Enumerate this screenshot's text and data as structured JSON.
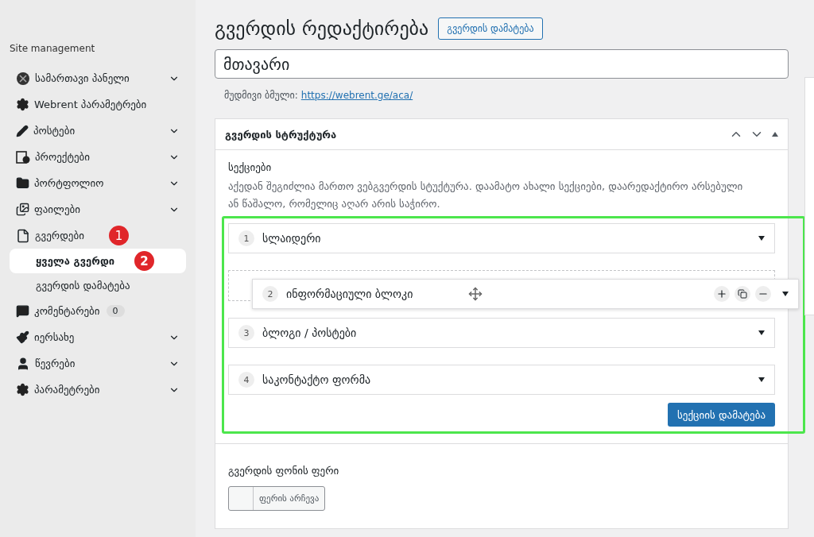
{
  "sidebar": {
    "heading": "Site management",
    "items": [
      {
        "label": "სამართავი პანელი",
        "chevron": true
      },
      {
        "label": "Webrent პარამეტრები",
        "chevron": false
      },
      {
        "label": "პოსტები",
        "chevron": true
      },
      {
        "label": "პროექტები",
        "chevron": true
      },
      {
        "label": "პორტფოლიო",
        "chevron": true
      },
      {
        "label": "ფაილები",
        "chevron": true
      },
      {
        "label": "გვერდები",
        "chevron": false,
        "marker": "1",
        "children": [
          {
            "label": "ყველა გვერდი",
            "selected": true,
            "marker": "2"
          },
          {
            "label": "გვერდის დამატება",
            "selected": false
          }
        ]
      },
      {
        "label": "კომენტარები",
        "chevron": false,
        "count": "0"
      },
      {
        "label": "იერსახე",
        "chevron": true
      },
      {
        "label": "წევრები",
        "chevron": true
      },
      {
        "label": "პარამეტრები",
        "chevron": true
      }
    ]
  },
  "header": {
    "title": "გვერდის რედაქტირება",
    "add_button": "გვერდის დამატება"
  },
  "title_field": {
    "value": "მთავარი"
  },
  "permalink": {
    "label": "მუდმივი ბმული:",
    "url": "https://webrent.ge/aca/"
  },
  "structure_panel": {
    "title": "გვერდის სტრუქტურა",
    "sections_label": "სექციები",
    "description": "აქედან შეგიძლია მართო ვებგვერდის სტუქტურა. დაამატო ახალი სექციები, დაარედაქტირო არსებული ან წაშალო, რომელიც აღარ არის საჭირო.",
    "sections": [
      {
        "number": "1",
        "title": "სლაიდერი",
        "dragging": false
      },
      {
        "number": "2",
        "title": "ინფორმაციული ბლოკი",
        "dragging": true
      },
      {
        "number": "3",
        "title": "ბლოგი / პოსტები",
        "dragging": false
      },
      {
        "number": "4",
        "title": "საკონტაქტო ფორმა",
        "dragging": false
      }
    ],
    "add_section_button": "სექციის დამატება"
  },
  "background_color": {
    "label": "გვერდის ფონის ფერი",
    "button": "ფერის არჩევა"
  }
}
